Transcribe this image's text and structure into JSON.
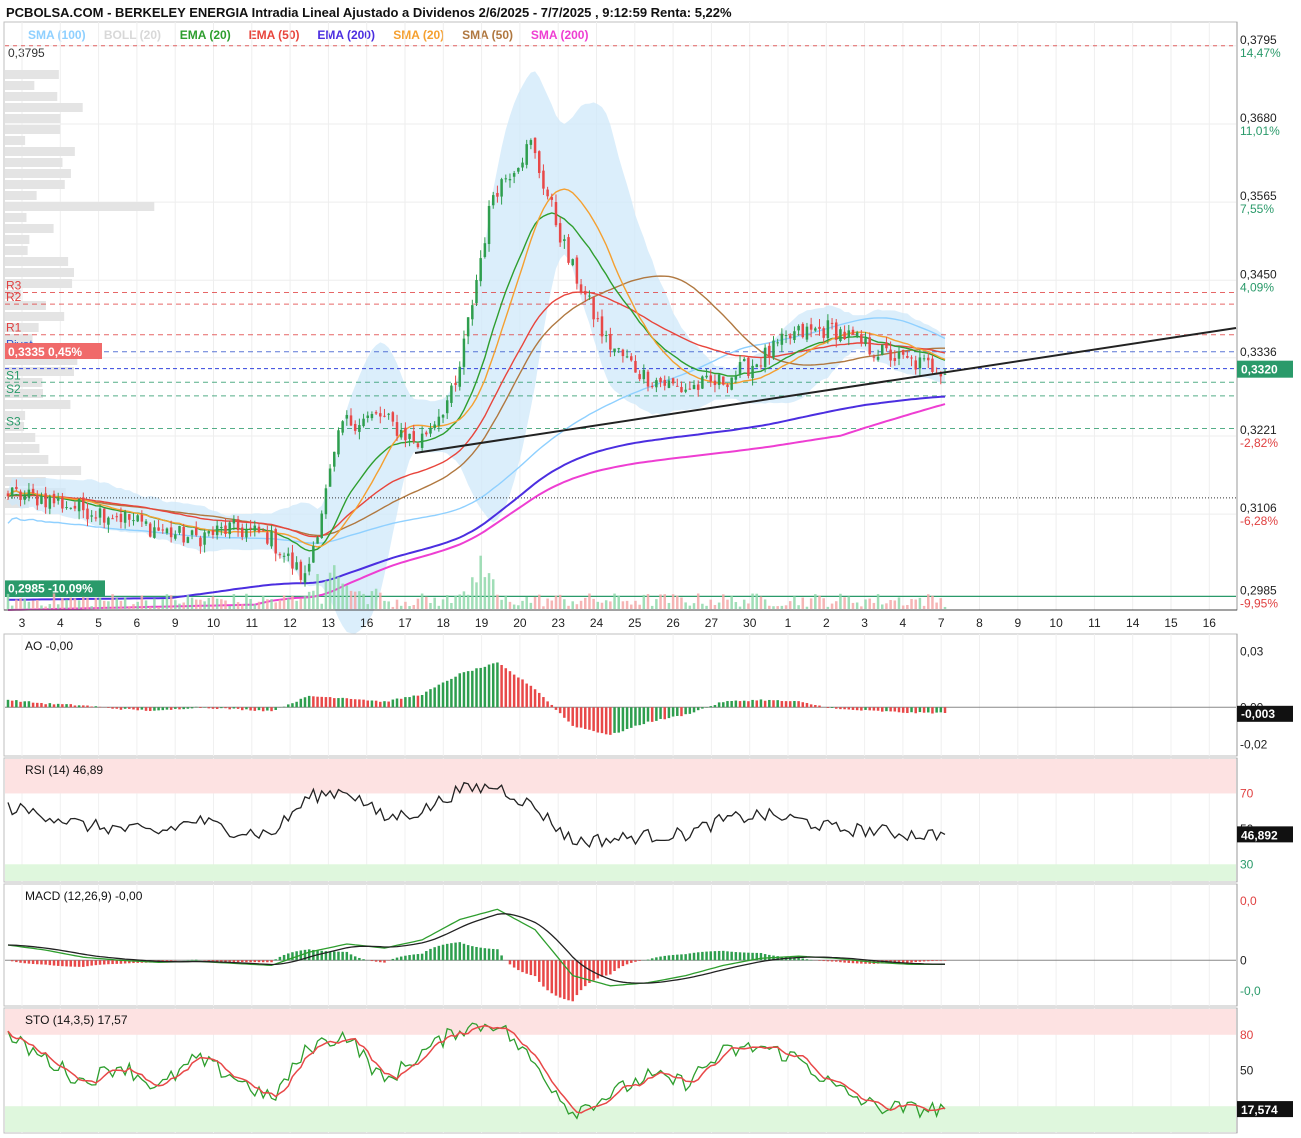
{
  "header": {
    "title": "PCBOLSA.COM - BERKELEY ENERGIA Intradia Lineal Ajustado a Dividenos 2/6/2025 - 7/7/2025 , 9:12:59 Renta: 5,22%",
    "top_price": "0,3795"
  },
  "legend": [
    {
      "label": "SMA (100)",
      "color": "#8fd0ff"
    },
    {
      "label": "BOLL (20)",
      "color": "#d8d8d8"
    },
    {
      "label": "EMA (20)",
      "color": "#2e9e2e"
    },
    {
      "label": "EMA (50)",
      "color": "#e8453c"
    },
    {
      "label": "EMA (200)",
      "color": "#4b2ee0"
    },
    {
      "label": "SMA (20)",
      "color": "#f5a030"
    },
    {
      "label": "SMA (50)",
      "color": "#b07840"
    },
    {
      "label": "SMA (200)",
      "color": "#ee3ed2"
    }
  ],
  "price_axis": [
    {
      "price": "0,3795",
      "pct": "14,47%",
      "pct_color": "#2a9a6a"
    },
    {
      "price": "0,3680",
      "pct": "11,01%",
      "pct_color": "#2a9a6a"
    },
    {
      "price": "0,3565",
      "pct": "7,55%",
      "pct_color": "#2a9a6a"
    },
    {
      "price": "0,3450",
      "pct": "4,09%",
      "pct_color": "#2a9a6a"
    },
    {
      "price": "0,3336",
      "pct": "",
      "pct_color": "#2a9a6a"
    },
    {
      "price": "0,3221",
      "pct": "-2,82%",
      "pct_color": "#e04040"
    },
    {
      "price": "0,3106",
      "pct": "-6,28%",
      "pct_color": "#e04040"
    },
    {
      "price": "0,2985",
      "pct": "-9,95%",
      "pct_color": "#e04040"
    }
  ],
  "current_price_label": "0,3320",
  "pivot_labels": [
    {
      "label": "R3",
      "price": 0.3432,
      "color": "#e04040"
    },
    {
      "label": "R2",
      "price": 0.3415,
      "color": "#e04040"
    },
    {
      "label": "R1",
      "price": 0.337,
      "color": "#e04040"
    },
    {
      "label": "Pivot",
      "price": 0.3345,
      "color": "#3355cc"
    },
    {
      "label": "S1",
      "price": 0.33,
      "color": "#2a9a6a"
    },
    {
      "label": "S2",
      "price": 0.328,
      "color": "#2a9a6a"
    },
    {
      "label": "S3",
      "price": 0.3232,
      "color": "#2a9a6a"
    }
  ],
  "left_tags": {
    "upper": "0,3335  0,45%",
    "lower": "0,2985  -10,09%"
  },
  "x_axis_labels": [
    "3",
    "4",
    "5",
    "6",
    "9",
    "10",
    "11",
    "12",
    "13",
    "16",
    "17",
    "18",
    "19",
    "20",
    "23",
    "24",
    "25",
    "26",
    "27",
    "30",
    "1",
    "2",
    "3",
    "4",
    "7",
    "8",
    "9",
    "10",
    "11",
    "14",
    "15",
    "16"
  ],
  "indicators": {
    "ao": {
      "label": "AO",
      "value": "-0,00",
      "axis": [
        "0,03",
        "0,00",
        "-0,02"
      ],
      "current": "-0,003"
    },
    "rsi": {
      "label": "RSI (14)",
      "value": "46,89",
      "axis": [
        "70",
        "50",
        "30"
      ],
      "current": "46,892"
    },
    "macd": {
      "label": "MACD (12,26,9)",
      "value": "-0,00",
      "axis": [
        "0,0",
        "0",
        "-0,0"
      ]
    },
    "sto": {
      "label": "STO (14,3,5)",
      "value": "17,57",
      "axis": [
        "80",
        "50"
      ],
      "current": "17,574"
    }
  },
  "chart_data": [
    {
      "type": "candlestick",
      "title": "BERKELEY ENERGIA",
      "categories": [
        "3",
        "4",
        "5",
        "6",
        "9",
        "10",
        "11",
        "12",
        "13",
        "16",
        "17",
        "18",
        "19",
        "20",
        "23",
        "24",
        "25",
        "26",
        "27",
        "30",
        "1",
        "2",
        "3",
        "4",
        "7"
      ],
      "close": [
        0.313,
        0.3115,
        0.3105,
        0.3085,
        0.307,
        0.3085,
        0.3075,
        0.301,
        0.324,
        0.325,
        0.321,
        0.329,
        0.358,
        0.365,
        0.348,
        0.336,
        0.331,
        0.329,
        0.33,
        0.333,
        0.337,
        0.338,
        0.335,
        0.333,
        0.332
      ],
      "ylim": [
        0.2965,
        0.383
      ],
      "reference_levels": [
        0.3795,
        0.2985
      ],
      "current": 0.332
    },
    {
      "type": "bar",
      "title": "AO",
      "categories": [
        "3",
        "4",
        "5",
        "6",
        "9",
        "10",
        "11",
        "12",
        "13",
        "16",
        "17",
        "18",
        "19",
        "20",
        "23",
        "24",
        "25",
        "26",
        "27",
        "30",
        "1",
        "2",
        "3",
        "4",
        "7"
      ],
      "values": [
        0.004,
        0.002,
        0.001,
        -0.001,
        -0.002,
        0.0,
        -0.001,
        -0.002,
        0.006,
        0.005,
        0.003,
        0.007,
        0.018,
        0.024,
        0.01,
        -0.01,
        -0.015,
        -0.008,
        -0.004,
        0.003,
        0.004,
        0.003,
        -0.001,
        -0.002,
        -0.003
      ],
      "ylim": [
        -0.022,
        0.032
      ]
    },
    {
      "type": "line",
      "title": "RSI (14)",
      "categories": [
        "3",
        "4",
        "5",
        "6",
        "9",
        "10",
        "11",
        "12",
        "13",
        "16",
        "17",
        "18",
        "19",
        "20",
        "23",
        "24",
        "25",
        "26",
        "27",
        "30",
        "1",
        "2",
        "3",
        "4",
        "7"
      ],
      "values": [
        62,
        58,
        52,
        50,
        48,
        55,
        49,
        47,
        68,
        72,
        56,
        60,
        72,
        74,
        62,
        43,
        44,
        46,
        47,
        55,
        58,
        55,
        50,
        49,
        46.89
      ],
      "ylim": [
        20,
        90
      ]
    },
    {
      "type": "line",
      "title": "MACD (12,26,9)",
      "categories": [
        "3",
        "4",
        "5",
        "6",
        "9",
        "10",
        "11",
        "12",
        "13",
        "16",
        "17",
        "18",
        "19",
        "20",
        "23",
        "24",
        "25",
        "26",
        "27",
        "30",
        "1",
        "2",
        "3",
        "4",
        "7"
      ],
      "values": [
        0.0015,
        0.001,
        0.0003,
        0.0,
        -0.0002,
        -0.0001,
        -0.0003,
        -0.0005,
        0.0008,
        0.0016,
        0.0012,
        0.002,
        0.004,
        0.005,
        0.003,
        -0.0015,
        -0.0025,
        -0.0022,
        -0.0015,
        -0.0005,
        0.0002,
        0.0004,
        0.0002,
        -0.0002,
        -0.0004
      ],
      "ylim": [
        -0.0035,
        0.0065
      ]
    },
    {
      "type": "line",
      "title": "STO (14,3,5)",
      "categories": [
        "3",
        "4",
        "5",
        "6",
        "9",
        "10",
        "11",
        "12",
        "13",
        "16",
        "17",
        "18",
        "19",
        "20",
        "23",
        "24",
        "25",
        "26",
        "27",
        "30",
        "1",
        "2",
        "3",
        "4",
        "7"
      ],
      "values": [
        78,
        60,
        40,
        55,
        35,
        60,
        45,
        25,
        70,
        80,
        40,
        65,
        85,
        90,
        55,
        15,
        30,
        45,
        40,
        65,
        70,
        60,
        35,
        20,
        17.57
      ],
      "ylim": [
        0,
        100
      ]
    }
  ]
}
